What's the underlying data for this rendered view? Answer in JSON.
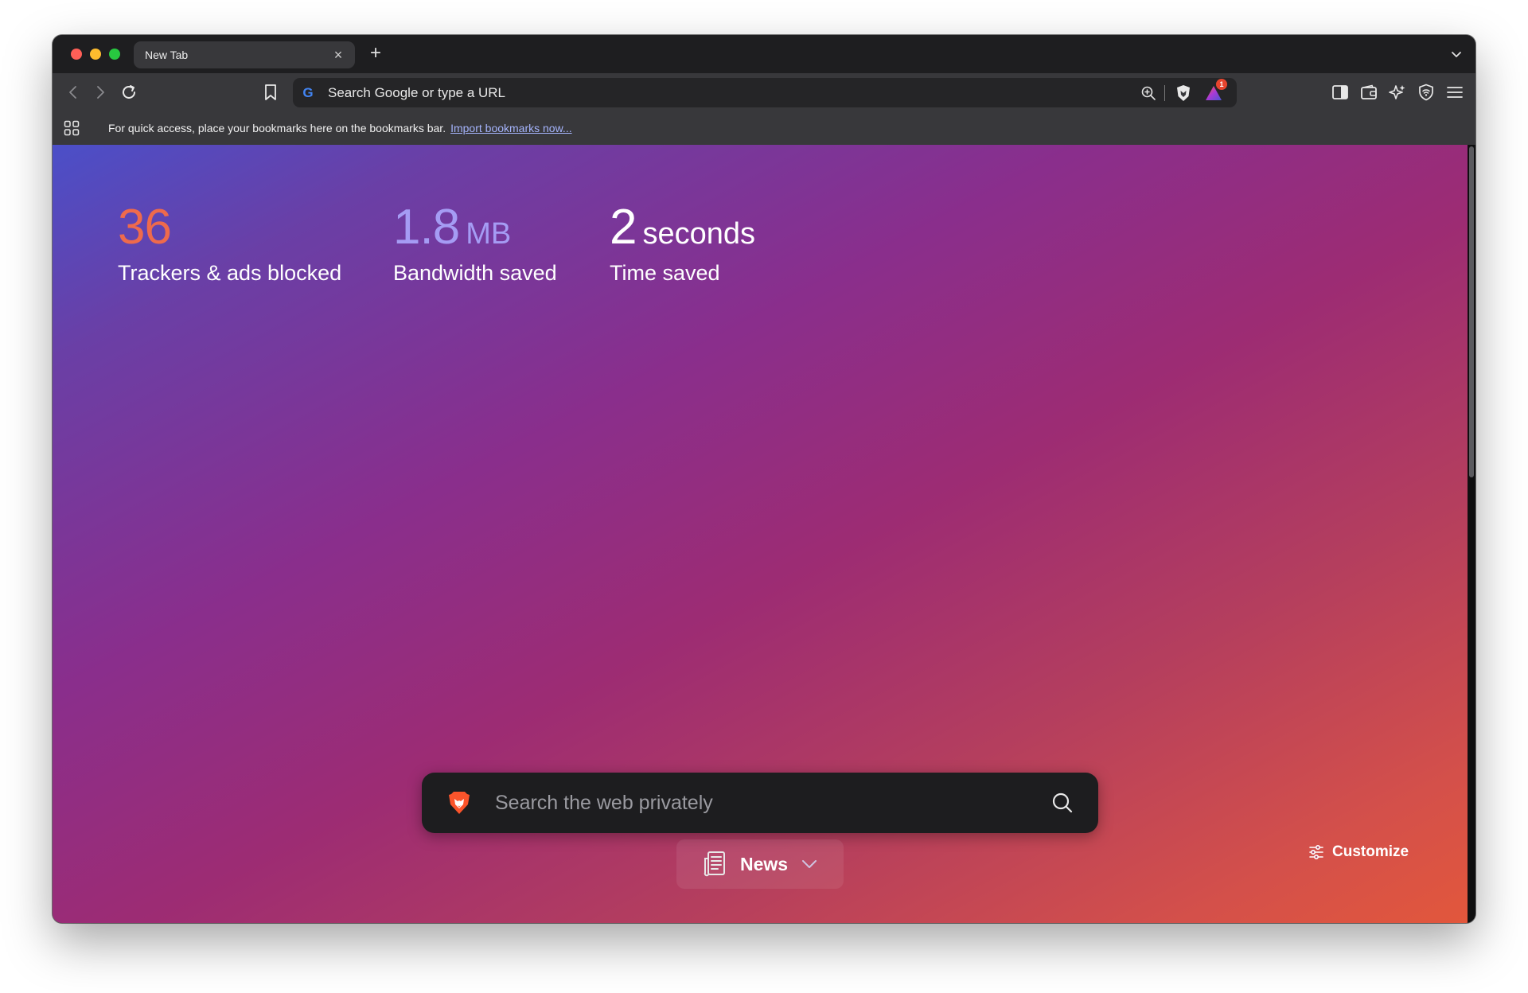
{
  "window": {
    "tab": {
      "title": "New Tab",
      "close_glyph": "×"
    },
    "new_tab_glyph": "+"
  },
  "toolbar": {
    "address_placeholder": "Search Google or type a URL",
    "search_engine_logo": "G",
    "rewards_badge": "1"
  },
  "bookmarks_bar": {
    "message": "For quick access, place your bookmarks here on the bookmarks bar.",
    "import_link": "Import bookmarks now..."
  },
  "stats": {
    "trackers": {
      "value": "36",
      "unit": "",
      "label": "Trackers & ads blocked"
    },
    "bandwidth": {
      "value": "1.8",
      "unit": "MB",
      "label": "Bandwidth saved"
    },
    "time": {
      "value": "2",
      "unit": "seconds",
      "label": "Time saved"
    }
  },
  "search": {
    "placeholder": "Search the web privately"
  },
  "news": {
    "label": "News"
  },
  "customize": {
    "label": "Customize"
  },
  "colors": {
    "trackers_accent": "#ee6a4c",
    "bandwidth_accent": "#a59cf4",
    "brave_orange": "#fb542b",
    "badge": "#e8452e"
  }
}
